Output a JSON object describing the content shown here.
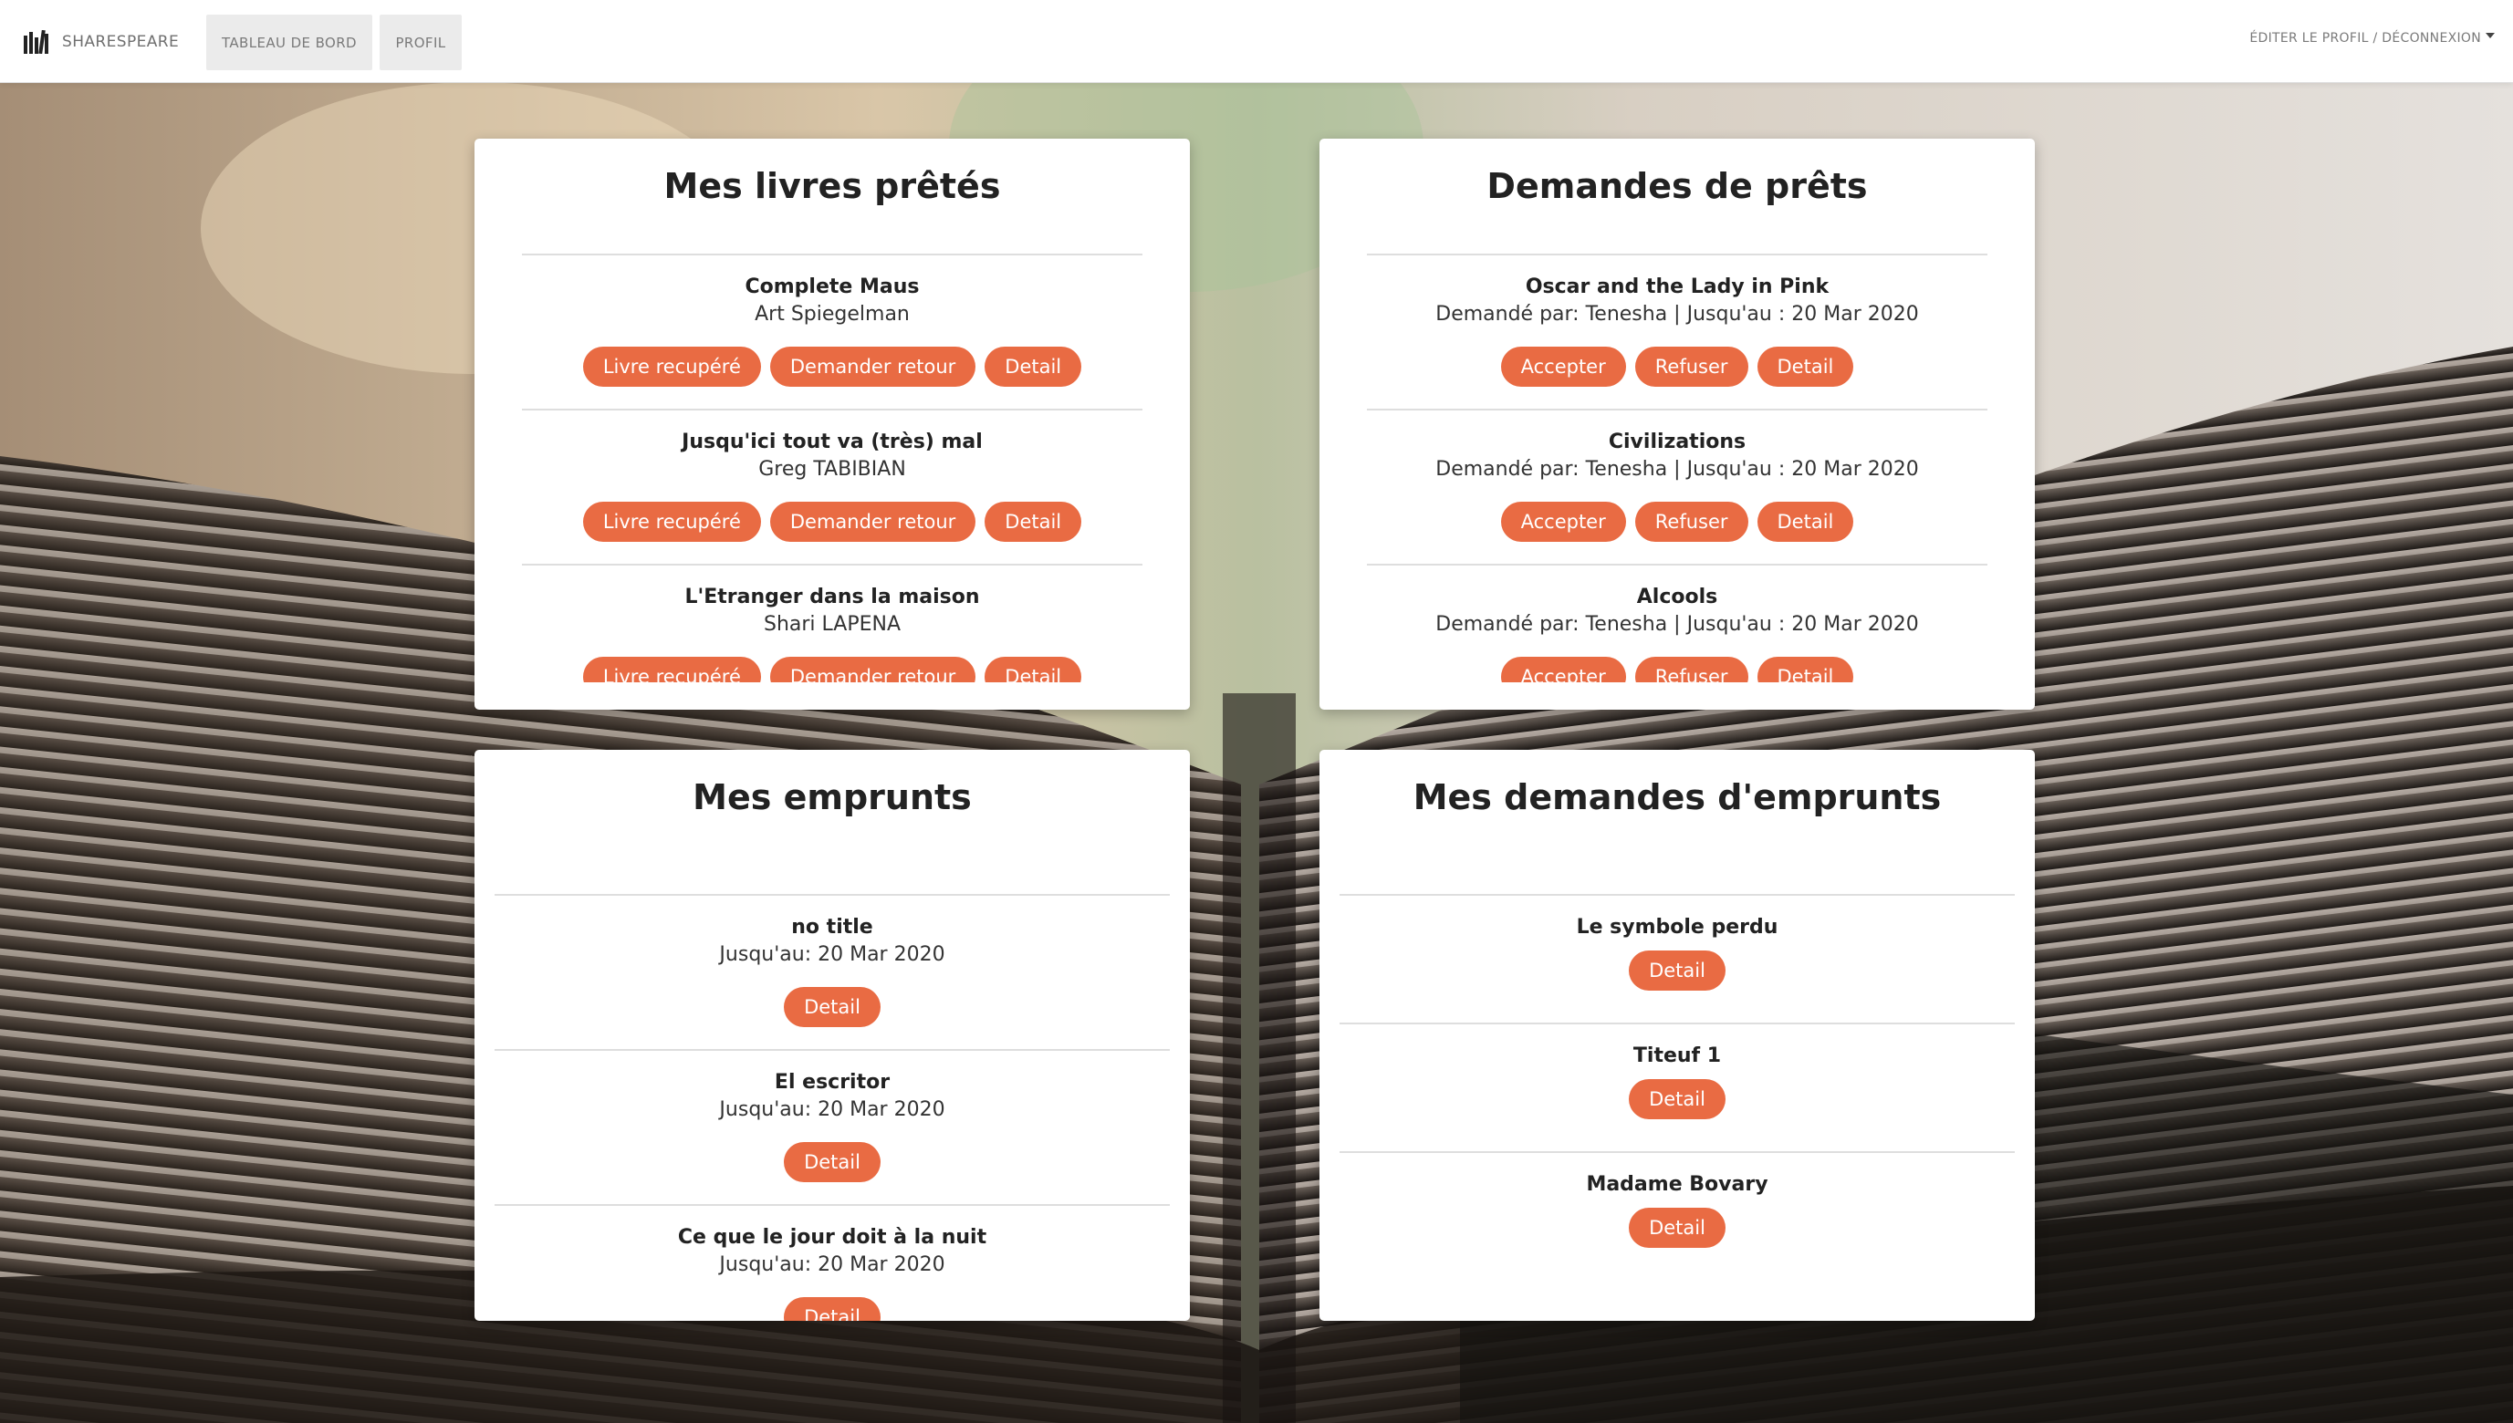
{
  "navbar": {
    "brand": "SHARESPEARE",
    "tabs": [
      {
        "label": "TABLEAU DE BORD"
      },
      {
        "label": "PROFIL"
      }
    ],
    "user_menu": "ÉDITER LE PROFIL / DÉCONNEXION"
  },
  "colors": {
    "accent": "#e96b43",
    "card_bg": "#ffffff",
    "nav_bg": "#ffffff",
    "nav_tab_bg": "#ebebeb"
  },
  "icons": {
    "brand": "books-icon",
    "user_menu": "chevron-down-icon"
  },
  "lent_books": {
    "title": "Mes livres prêtés",
    "items": [
      {
        "title": "Complete Maus",
        "subtitle": "Art Spiegelman",
        "buttons": [
          "Livre recupéré",
          "Demander retour",
          "Detail"
        ]
      },
      {
        "title": "Jusqu'ici tout va (très) mal",
        "subtitle": "Greg TABIBIAN",
        "buttons": [
          "Livre recupéré",
          "Demander retour",
          "Detail"
        ]
      },
      {
        "title": "L'Etranger dans la maison",
        "subtitle": "Shari LAPENA",
        "buttons": [
          "Livre recupéré",
          "Demander retour",
          "Detail"
        ]
      }
    ]
  },
  "loan_requests": {
    "title": "Demandes de prêts",
    "items": [
      {
        "title": "Oscar and the Lady in Pink",
        "subtitle": "Demandé par: Tenesha | Jusqu'au : 20 Mar 2020",
        "buttons": [
          "Accepter",
          "Refuser",
          "Detail"
        ]
      },
      {
        "title": "Civilizations",
        "subtitle": "Demandé par: Tenesha | Jusqu'au : 20 Mar 2020",
        "buttons": [
          "Accepter",
          "Refuser",
          "Detail"
        ]
      },
      {
        "title": "Alcools",
        "subtitle": "Demandé par: Tenesha | Jusqu'au : 20 Mar 2020",
        "buttons": [
          "Accepter",
          "Refuser",
          "Detail"
        ]
      }
    ]
  },
  "borrowings": {
    "title": "Mes emprunts",
    "items": [
      {
        "title": "no title",
        "subtitle": "Jusqu'au: 20 Mar 2020",
        "buttons": [
          "Detail"
        ]
      },
      {
        "title": "El escritor",
        "subtitle": "Jusqu'au: 20 Mar 2020",
        "buttons": [
          "Detail"
        ]
      },
      {
        "title": "Ce que le jour doit à la nuit",
        "subtitle": "Jusqu'au: 20 Mar 2020",
        "buttons": [
          "Detail"
        ]
      }
    ]
  },
  "borrow_requests": {
    "title": "Mes demandes d'emprunts",
    "items": [
      {
        "title": "Le symbole perdu",
        "buttons": [
          "Detail"
        ]
      },
      {
        "title": "Titeuf 1",
        "buttons": [
          "Detail"
        ]
      },
      {
        "title": "Madame Bovary",
        "buttons": [
          "Detail"
        ]
      }
    ]
  }
}
